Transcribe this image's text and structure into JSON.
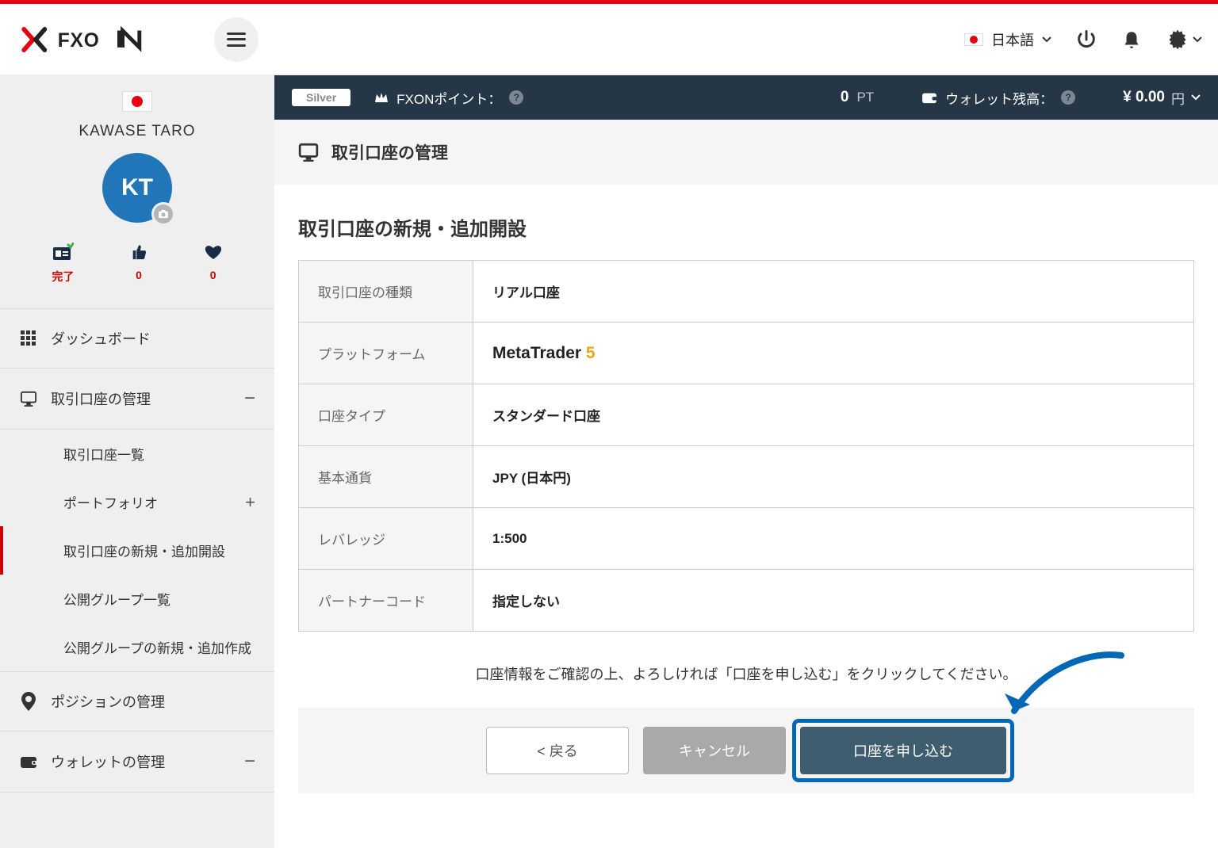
{
  "header": {
    "language": "日本語"
  },
  "profile": {
    "name": "KAWASE TARO",
    "initials": "KT",
    "stats": {
      "done": "完了",
      "likes": "0",
      "favs": "0"
    }
  },
  "sidebar": {
    "dashboard": "ダッシュボード",
    "account_mgmt": "取引口座の管理",
    "sub": {
      "list": "取引口座一覧",
      "portfolio": "ポートフォリオ",
      "new_account": "取引口座の新規・追加開設",
      "public_groups": "公開グループ一覧",
      "public_groups_new": "公開グループの新規・追加作成"
    },
    "position_mgmt": "ポジションの管理",
    "wallet_mgmt": "ウォレットの管理"
  },
  "status": {
    "tier": "Silver",
    "points_label": "FXONポイント：",
    "points_value": "0",
    "points_unit": "PT",
    "wallet_label": "ウォレット残高：",
    "balance": "¥ 0.00",
    "currency": "円"
  },
  "page": {
    "title": "取引口座の管理",
    "section_title": "取引口座の新規・追加開設",
    "rows": {
      "type_label": "取引口座の種類",
      "type_value": "リアル口座",
      "platform_label": "プラットフォーム",
      "platform_value_a": "MetaTrader",
      "platform_value_b": "5",
      "acct_label": "口座タイプ",
      "acct_value": "スタンダード口座",
      "currency_label": "基本通貨",
      "currency_value": "JPY (日本円)",
      "leverage_label": "レバレッジ",
      "leverage_value": "1:500",
      "partner_label": "パートナーコード",
      "partner_value": "指定しない"
    },
    "confirm_note": "口座情報をご確認の上、よろしければ「口座を申し込む」をクリックしてください。",
    "buttons": {
      "back": "<  戻る",
      "cancel": "キャンセル",
      "submit": "口座を申し込む"
    }
  }
}
